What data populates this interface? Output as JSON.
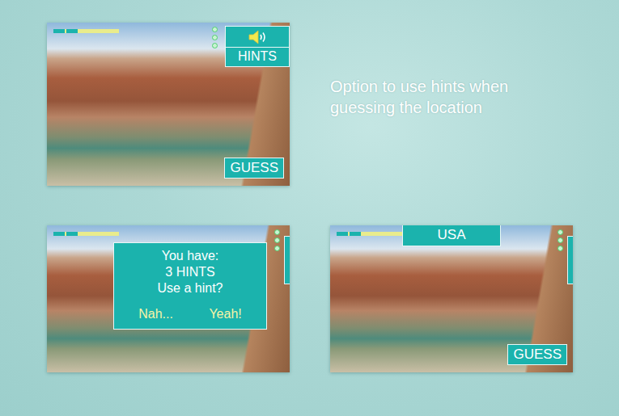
{
  "caption": "Option to use hints when guessing the location",
  "screens": [
    {
      "kind": "start",
      "progress": {
        "level": 0.38
      },
      "hints_label": "HINTS",
      "guess_label": "GUESS"
    },
    {
      "kind": "dialog",
      "progress": {
        "level": 0.38
      },
      "dialog": {
        "lines": [
          "You have:",
          "3 HINTS",
          "Use a hint?"
        ],
        "buttons": [
          "Nah...",
          "Yeah!"
        ]
      }
    },
    {
      "kind": "hint",
      "progress": {
        "level": 0.38
      },
      "hint": "USA",
      "guess_label": "GUESS"
    }
  ]
}
